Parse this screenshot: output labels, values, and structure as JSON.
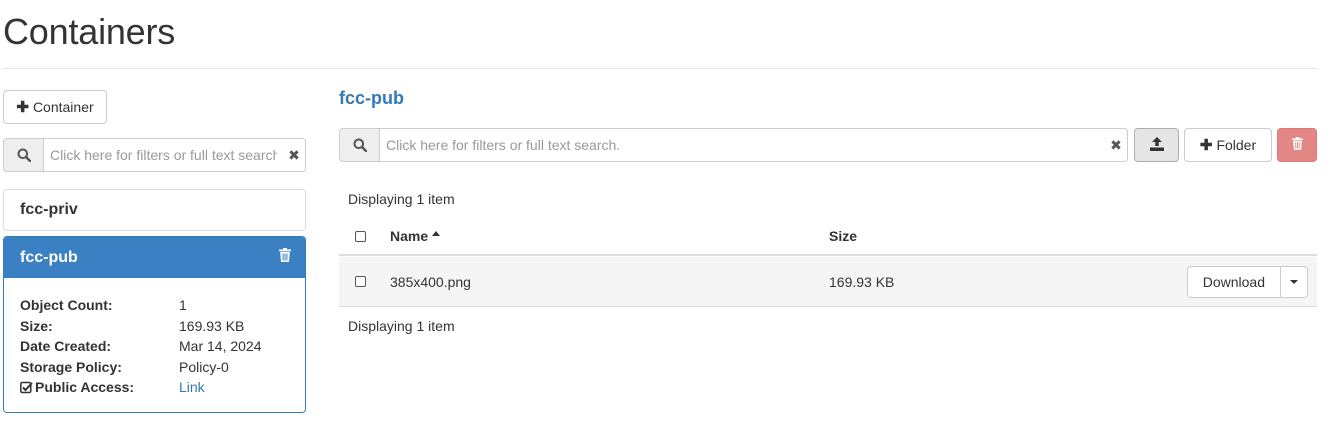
{
  "page": {
    "title": "Containers"
  },
  "sidebar": {
    "add_container_label": "Container",
    "search": {
      "placeholder": "Click here for filters or full text search."
    },
    "containers": [
      {
        "name": "fcc-priv"
      },
      {
        "name": "fcc-pub"
      }
    ],
    "active": {
      "name": "fcc-pub",
      "details": [
        {
          "label": "Object Count:",
          "value": "1"
        },
        {
          "label": "Size:",
          "value": "169.93 KB"
        },
        {
          "label": "Date Created:",
          "value": "Mar 14, 2024"
        },
        {
          "label": "Storage Policy:",
          "value": "Policy-0"
        }
      ],
      "public_access": {
        "label": "Public Access:",
        "value": "Link"
      }
    }
  },
  "main": {
    "container_title": "fcc-pub",
    "search": {
      "placeholder": "Click here for filters or full text search."
    },
    "folder_label": "Folder",
    "displaying_top": "Displaying 1 item",
    "displaying_bottom": "Displaying 1 item",
    "table": {
      "columns": {
        "name": "Name",
        "size": "Size"
      },
      "rows": [
        {
          "name": "385x400.png",
          "size": "169.93 KB",
          "action": "Download"
        }
      ]
    }
  },
  "colors": {
    "accent": "#337ab7",
    "active_header": "#3c80c4",
    "danger": "#e38785"
  },
  "icons": [
    "plus-icon",
    "search-icon",
    "clear-icon",
    "trash-icon",
    "upload-icon",
    "checkbox-checked-icon",
    "sort-ascending-icon",
    "caret-down-icon"
  ]
}
